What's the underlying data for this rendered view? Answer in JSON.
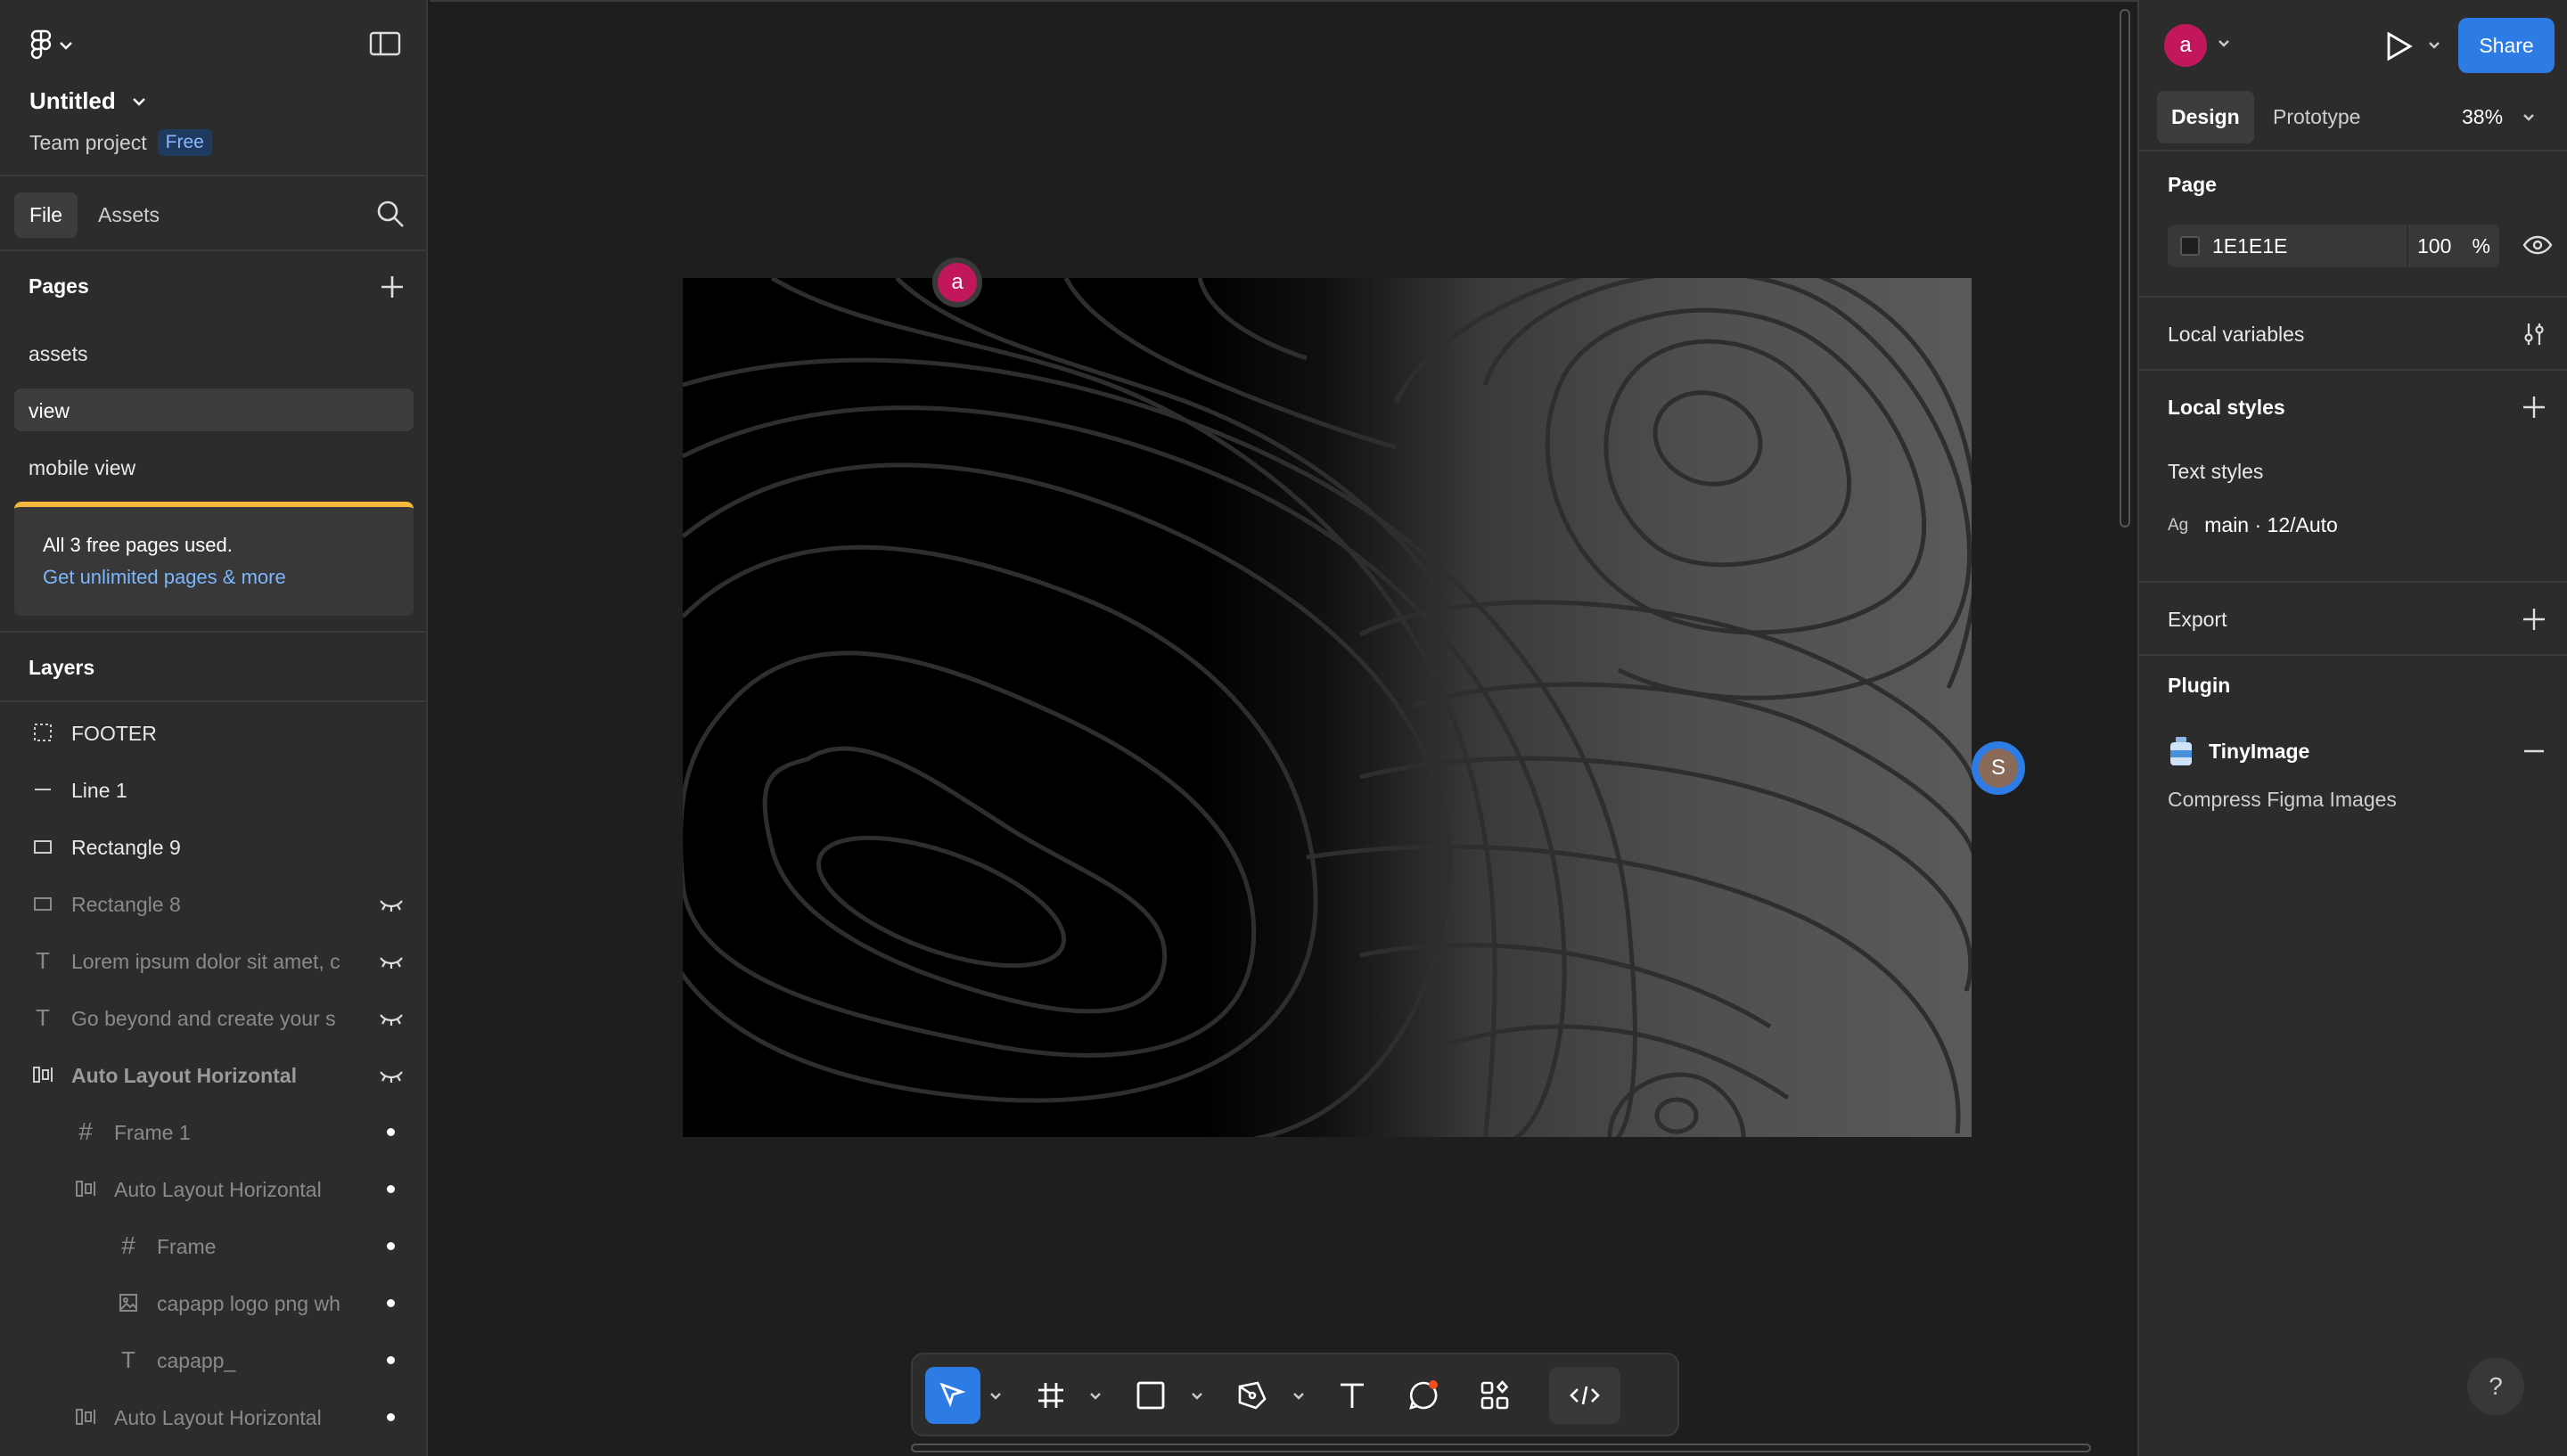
{
  "header": {
    "project_title": "Untitled",
    "team": "Team project",
    "plan_badge": "Free"
  },
  "file_tabs": {
    "file": "File",
    "assets": "Assets"
  },
  "pages": {
    "label": "Pages",
    "items": [
      {
        "label": "assets",
        "selected": false
      },
      {
        "label": "view",
        "selected": true
      },
      {
        "label": "mobile view",
        "selected": false
      }
    ],
    "notice": {
      "text": "All 3 free pages used.",
      "link": "Get unlimited pages & more"
    }
  },
  "layers": {
    "label": "Layers",
    "items": [
      {
        "name": "FOOTER",
        "icon": "frame-dashed-icon",
        "hidden": false
      },
      {
        "name": "Line 1",
        "icon": "line-icon",
        "hidden": false
      },
      {
        "name": "Rectangle 9",
        "icon": "rectangle-icon",
        "hidden": false
      },
      {
        "name": "Rectangle 8",
        "icon": "rectangle-icon",
        "hidden": true
      },
      {
        "name": "Lorem ipsum dolor sit amet, c",
        "icon": "text-icon",
        "hidden": true
      },
      {
        "name": "Go beyond and create your s",
        "icon": "text-icon",
        "hidden": true
      },
      {
        "name": "Auto Layout Horizontal",
        "icon": "auto-layout-icon",
        "hidden": true
      },
      {
        "name": "Frame 1",
        "icon": "frame-icon",
        "hidden": false
      },
      {
        "name": "Auto Layout Horizontal",
        "icon": "auto-layout-icon",
        "hidden": false
      },
      {
        "name": "Frame",
        "icon": "frame-icon",
        "hidden": false
      },
      {
        "name": "capapp logo png wh",
        "icon": "image-icon",
        "hidden": false
      },
      {
        "name": "capapp_",
        "icon": "text-icon",
        "hidden": false
      },
      {
        "name": "Auto Layout Horizontal",
        "icon": "auto-layout-icon",
        "hidden": false
      }
    ]
  },
  "canvas": {
    "cursor_a": "a",
    "cursor_s": "S"
  },
  "right_panel": {
    "avatar": "a",
    "share": "Share",
    "tabs": {
      "design": "Design",
      "prototype": "Prototype"
    },
    "zoom": "38%",
    "page": {
      "title": "Page",
      "color_hex": "1E1E1E",
      "opacity": "100",
      "opacity_unit": "%"
    },
    "local_variables": "Local variables",
    "local_styles": "Local styles",
    "text_styles": "Text styles",
    "style_item": {
      "prefix": "Ag",
      "name": "main · 12/Auto"
    },
    "export": "Export",
    "plugin": {
      "title": "Plugin",
      "name": "TinyImage",
      "desc": "Compress Figma Images"
    }
  },
  "help": "?",
  "colors": {
    "accent": "#2d7be5",
    "avatar": "#c2185b",
    "notice_bar": "#f6b73c",
    "link": "#7cb6ff"
  }
}
